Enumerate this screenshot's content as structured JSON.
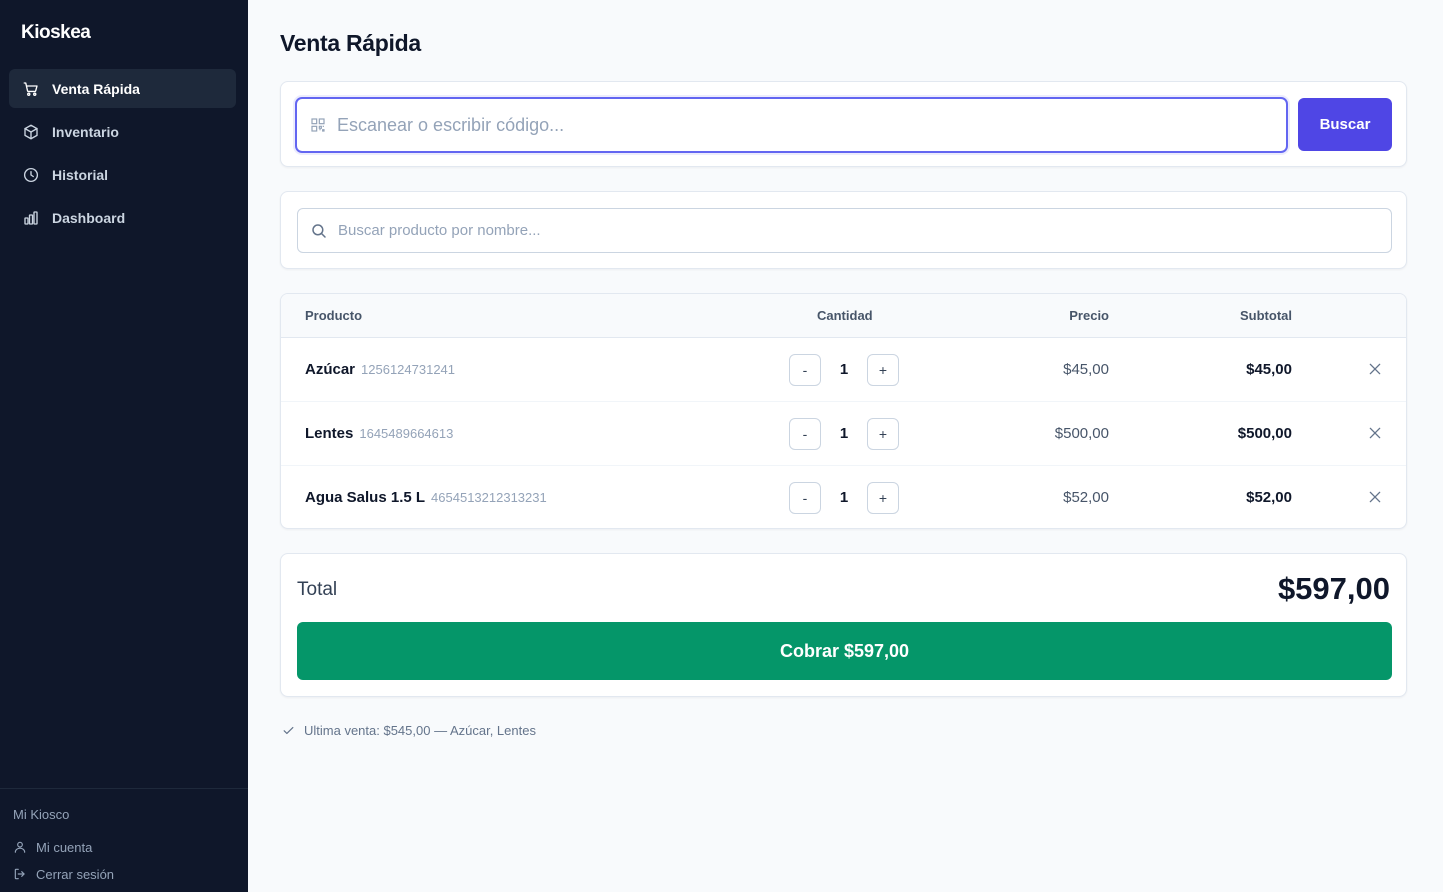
{
  "app": {
    "brand": "Kioskea"
  },
  "sidebar": {
    "items": [
      {
        "label": "Venta Rápida",
        "icon": "cart-icon",
        "active": true
      },
      {
        "label": "Inventario",
        "icon": "box-icon",
        "active": false
      },
      {
        "label": "Historial",
        "icon": "clock-icon",
        "active": false
      },
      {
        "label": "Dashboard",
        "icon": "bar-chart-icon",
        "active": false
      }
    ],
    "footer": {
      "org_name": "Mi Kiosco",
      "account_label": "Mi cuenta",
      "logout_label": "Cerrar sesión"
    }
  },
  "main": {
    "title": "Venta Rápida",
    "scan": {
      "placeholder": "Escanear o escribir código...",
      "value": "",
      "button_label": "Buscar"
    },
    "name_search": {
      "placeholder": "Buscar producto por nombre...",
      "value": ""
    },
    "table": {
      "headers": {
        "product": "Producto",
        "quantity": "Cantidad",
        "price": "Precio",
        "subtotal": "Subtotal"
      },
      "rows": [
        {
          "name": "Azúcar",
          "code": "1256124731241",
          "quantity": "1",
          "price": "$45,00",
          "subtotal": "$45,00"
        },
        {
          "name": "Lentes",
          "code": "1645489664613",
          "quantity": "1",
          "price": "$500,00",
          "subtotal": "$500,00"
        },
        {
          "name": "Agua Salus 1.5 L",
          "code": "4654513212313231",
          "quantity": "1",
          "price": "$52,00",
          "subtotal": "$52,00"
        }
      ],
      "minus_label": "-",
      "plus_label": "+"
    },
    "total": {
      "label": "Total",
      "value": "$597,00",
      "charge_button_label": "Cobrar $597,00"
    },
    "last_sale": "Ultima venta: $545,00 — Azúcar, Lentes"
  },
  "colors": {
    "sidebar_bg": "#0f172a",
    "accent": "#4f46e5",
    "focus_ring": "#6366f1",
    "charge": "#059669"
  }
}
